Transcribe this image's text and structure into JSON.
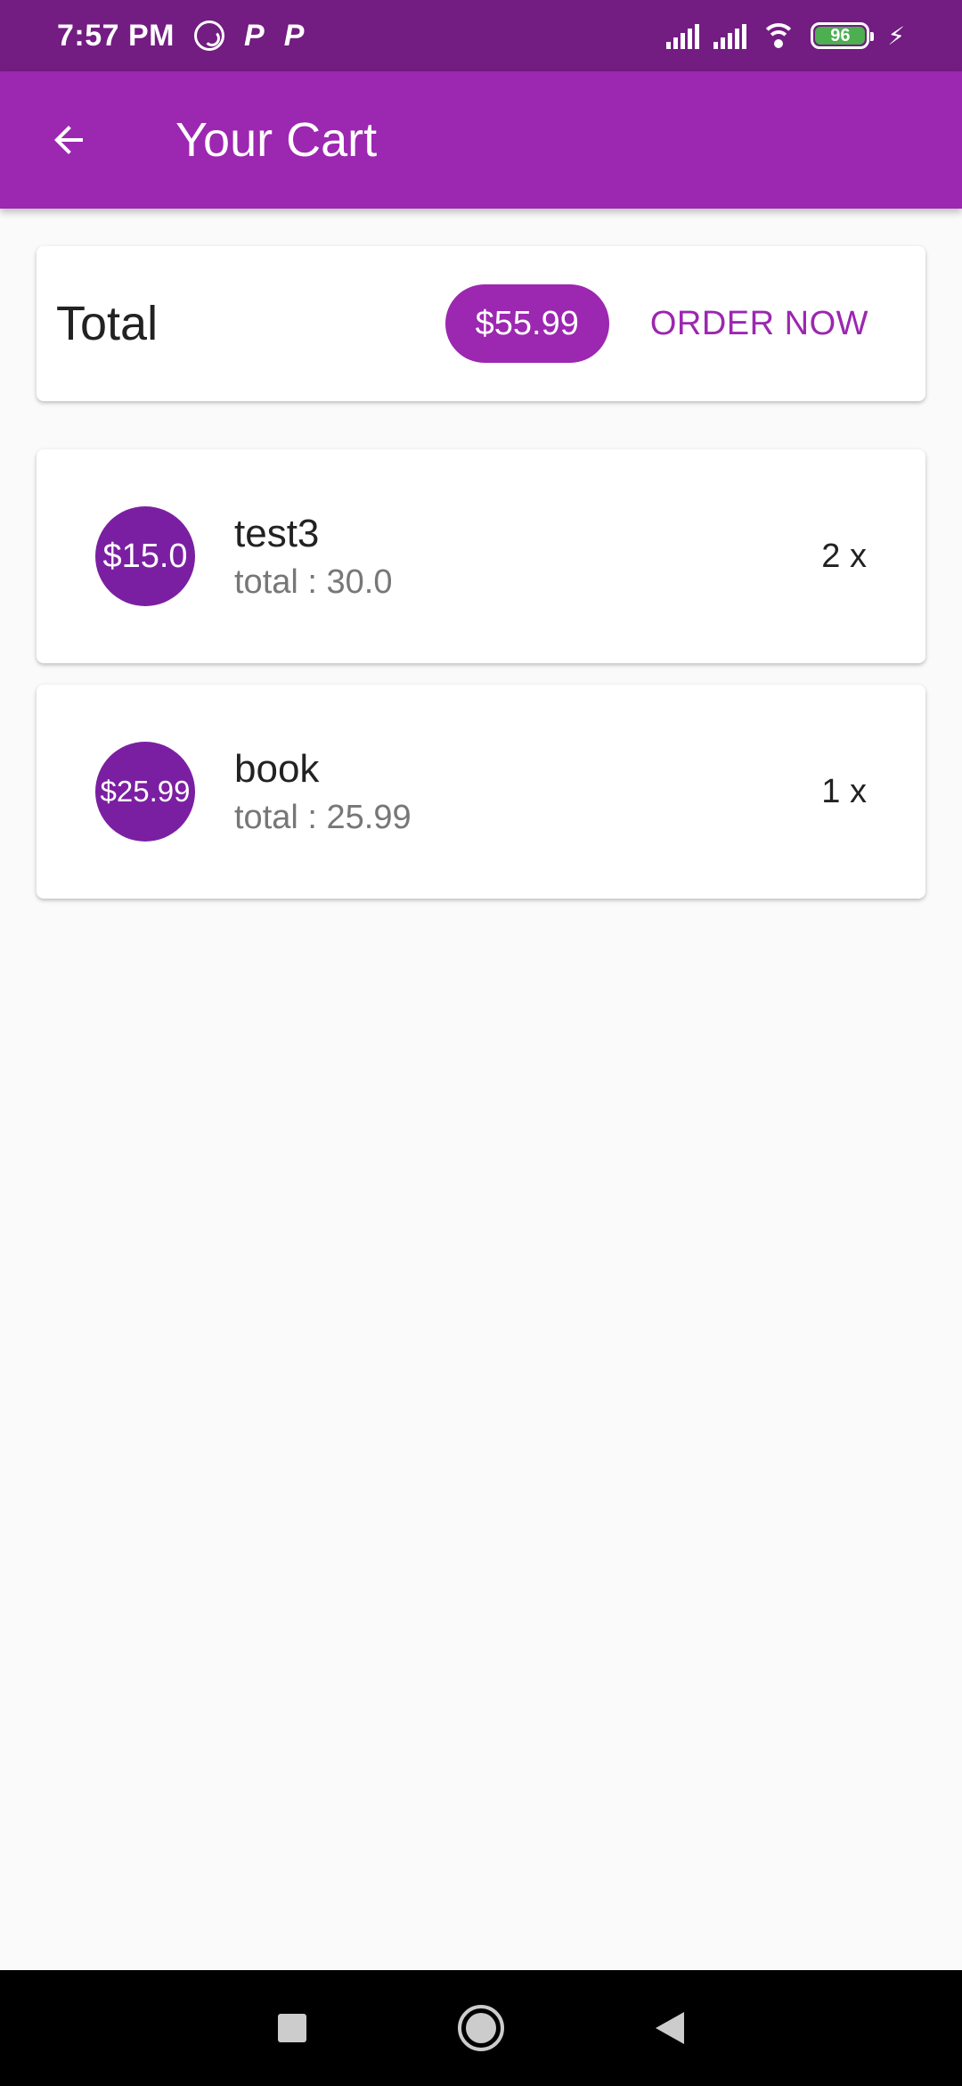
{
  "status_bar": {
    "time": "7:57 PM",
    "notification_icons": [
      "whatsapp-icon",
      "p-icon",
      "p-icon"
    ],
    "p_glyph": "P",
    "battery_level": "96"
  },
  "app_bar": {
    "title": "Your Cart",
    "back_icon": "arrow-back-icon",
    "color": "#9c27b0"
  },
  "summary": {
    "label": "Total",
    "amount": "$55.99",
    "order_button": "ORDER NOW"
  },
  "items": [
    {
      "price": "$15.0",
      "title": "test3",
      "subtitle": "total : 30.0",
      "quantity": "2 x"
    },
    {
      "price": "$25.99",
      "title": "book",
      "subtitle": "total : 25.99",
      "quantity": "1 x"
    }
  ],
  "nav_bar": {
    "buttons": [
      "recents-icon",
      "home-icon",
      "back-icon"
    ]
  }
}
